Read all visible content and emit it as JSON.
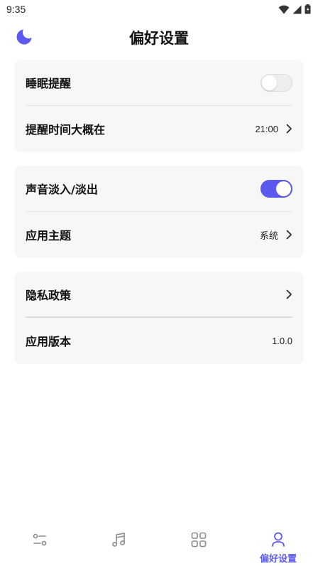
{
  "status_bar": {
    "time": "9:35"
  },
  "header": {
    "title": "偏好设置",
    "logo_icon": "moon-sleep-icon"
  },
  "colors": {
    "accent": "#5b59f0",
    "card_bg": "#f7f7f8",
    "inactive_icon": "#8a8a8f"
  },
  "sections": [
    {
      "rows": [
        {
          "label": "睡眠提醒",
          "control": "toggle",
          "on": false
        },
        {
          "label": "提醒时间大概在",
          "value": "21:00",
          "chevron": true
        }
      ]
    },
    {
      "rows": [
        {
          "label": "声音淡入/淡出",
          "control": "toggle",
          "on": true
        },
        {
          "label": "应用主题",
          "value": "系统",
          "chevron": true
        }
      ]
    },
    {
      "rows": [
        {
          "label": "隐私政策",
          "chevron": true
        },
        {
          "label": "应用版本",
          "value": "1.0.0"
        }
      ]
    }
  ],
  "bottom_nav": {
    "active_index": 3,
    "items": [
      {
        "icon": "sliders-icon",
        "label": ""
      },
      {
        "icon": "music-note-icon",
        "label": ""
      },
      {
        "icon": "grid-icon",
        "label": ""
      },
      {
        "icon": "profile-icon",
        "label": "偏好设置"
      }
    ]
  }
}
